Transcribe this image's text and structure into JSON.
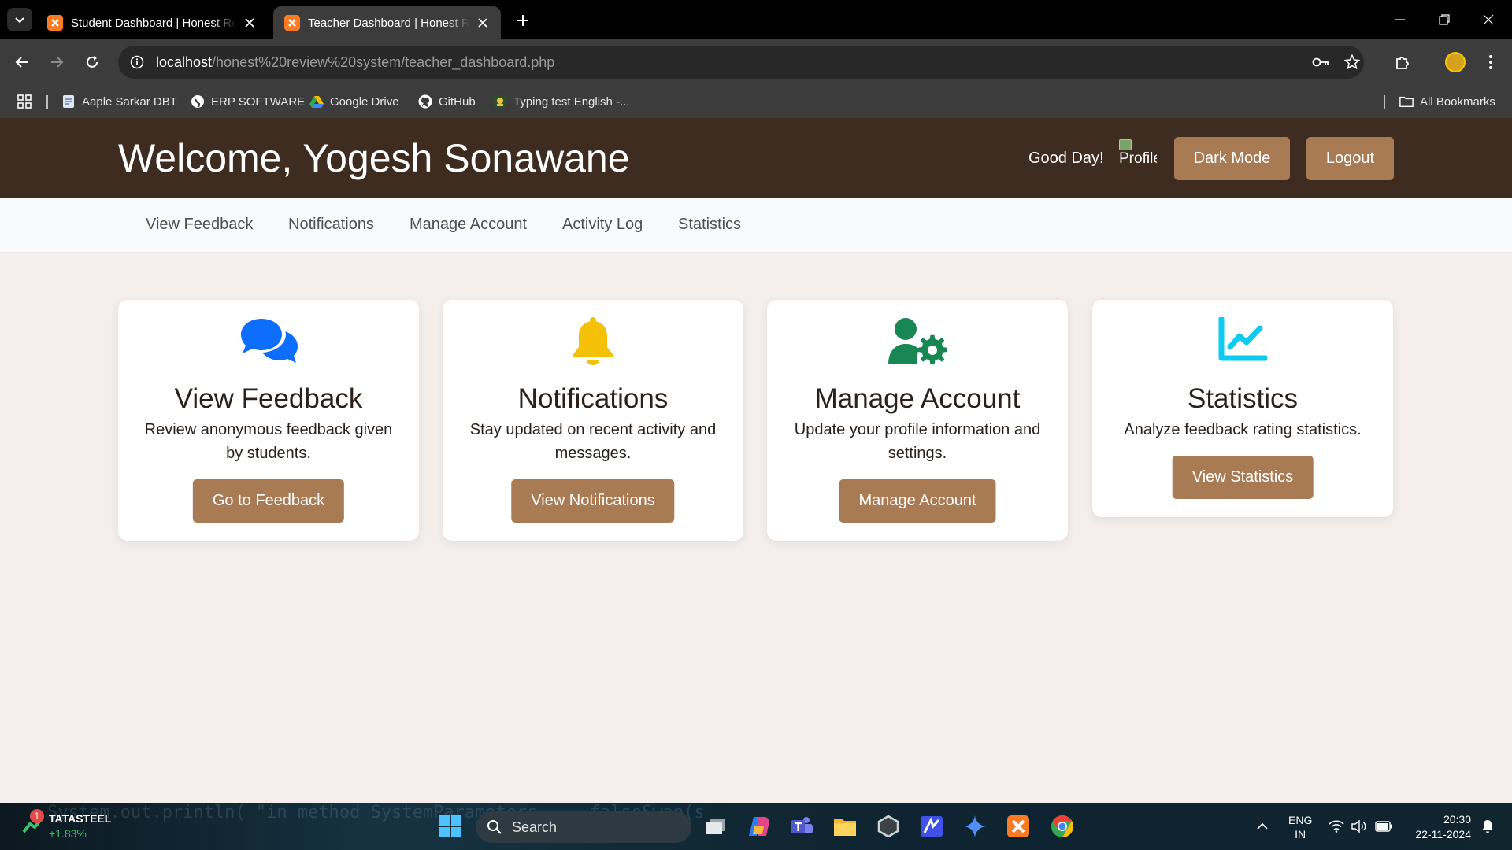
{
  "browser": {
    "tabs": [
      {
        "title": "Student Dashboard | Honest Re"
      },
      {
        "title": "Teacher Dashboard | Honest Re"
      }
    ],
    "url_host": "localhost",
    "url_path": "/honest%20review%20system/teacher_dashboard.php",
    "bookmarks": [
      {
        "label": "Aaple Sarkar DBT",
        "icon": "document-icon"
      },
      {
        "label": "ERP SOFTWARE",
        "icon": "globe-icon"
      },
      {
        "label": "Google Drive",
        "icon": "google-drive-icon"
      },
      {
        "label": "GitHub",
        "icon": "github-icon"
      },
      {
        "label": "Typing test English -...",
        "icon": "typing-site-icon"
      }
    ],
    "all_bookmarks": "All Bookmarks"
  },
  "header": {
    "welcome": "Welcome, Yogesh Sonawane",
    "greeting": "Good Day!",
    "profile_alt": "Profile",
    "dark_mode": "Dark Mode",
    "logout": "Logout"
  },
  "nav": {
    "items": [
      "View Feedback",
      "Notifications",
      "Manage Account",
      "Activity Log",
      "Statistics"
    ]
  },
  "cards": [
    {
      "title": "View Feedback",
      "desc": "Review anonymous feedback given by students.",
      "button": "Go to Feedback",
      "icon": "comments-icon",
      "color": "#0d6efd"
    },
    {
      "title": "Notifications",
      "desc": "Stay updated on recent activity and messages.",
      "button": "View Notifications",
      "icon": "bell-icon",
      "color": "#f5c107"
    },
    {
      "title": "Manage Account",
      "desc": "Update your profile information and settings.",
      "button": "Manage Account",
      "icon": "user-gear-icon",
      "color": "#198754"
    },
    {
      "title": "Statistics",
      "desc": "Analyze feedback rating statistics.",
      "button": "View Statistics",
      "icon": "chart-line-icon",
      "color": "#0dcaf0"
    }
  ],
  "colors": {
    "header_bg": "#3e2c21",
    "button_bg": "#a87b55",
    "page_bg": "#f4efec"
  },
  "taskbar": {
    "stock_name": "TATASTEEL",
    "stock_change": "+1.83%",
    "stock_badge": "1",
    "search_placeholder": "Search",
    "lang_line1": "ENG",
    "lang_line2": "IN",
    "time": "20:30",
    "date": "22-11-2024",
    "background_code": "System.out.println( \"in method SystemParameters ... falseSwap(s"
  }
}
